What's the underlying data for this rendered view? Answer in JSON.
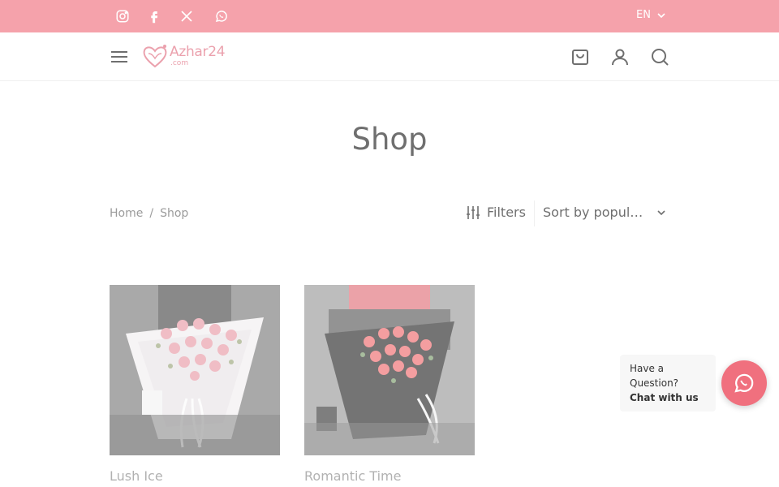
{
  "topbar": {
    "social": [
      "instagram-icon",
      "facebook-icon",
      "x-twitter-icon",
      "whatsapp-icon"
    ],
    "language": "EN",
    "bg_color": "#f0707e"
  },
  "header": {
    "logo_text": "Azhar24",
    "logo_sub": ".com",
    "icons": [
      "menu-icon",
      "cart-icon",
      "user-icon",
      "search-icon"
    ]
  },
  "page": {
    "title": "Shop"
  },
  "breadcrumb": {
    "home": "Home",
    "separator": "/",
    "current": "Shop"
  },
  "toolbar": {
    "filters_label": "Filters",
    "sort_label": "Sort by popul…"
  },
  "products": [
    {
      "name": "Lush Ice",
      "bouquet_wrap": "white",
      "flower_color": "pink"
    },
    {
      "name": "Romantic Time",
      "bouquet_wrap": "black",
      "flower_color": "red"
    }
  ],
  "chat": {
    "line1": "Have a Question?",
    "cta": "Chat with us"
  }
}
